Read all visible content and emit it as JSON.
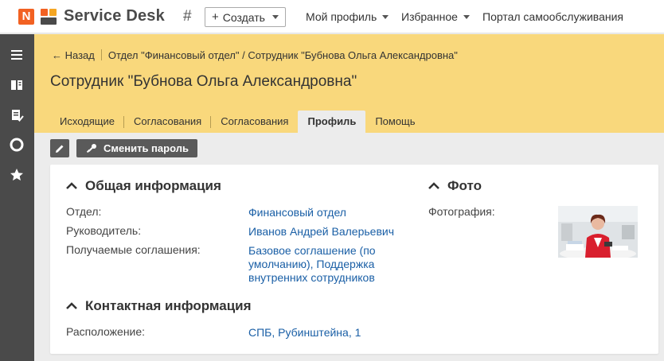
{
  "app": {
    "logo_letter": "N",
    "name": "Service Desk",
    "hash_symbol": "#",
    "create_label": "Создать",
    "create_plus": "+",
    "nav": [
      {
        "label": "Мой профиль"
      },
      {
        "label": "Избранное"
      },
      {
        "label": "Портал самообслуживания"
      }
    ]
  },
  "sidebar": {
    "items": [
      "menu-icon",
      "book-icon",
      "task-list-icon",
      "lifebuoy-icon",
      "star-icon"
    ]
  },
  "breadcrumb": {
    "back": "← Назад",
    "path": "Отдел \"Финансовый отдел\" / Сотрудник \"Бубнова Ольга Александровна\""
  },
  "page_title": "Сотрудник \"Бубнова Ольга Александровна\"",
  "tabs": [
    {
      "label": "Исходящие"
    },
    {
      "label": "Согласования"
    },
    {
      "label": "Согласования"
    },
    {
      "label": "Профиль"
    },
    {
      "label": "Помощь"
    }
  ],
  "toolbar": {
    "change_password": "Сменить пароль"
  },
  "general": {
    "title": "Общая информация",
    "department_label": "Отдел:",
    "department_value": "Финансовый отдел",
    "manager_label": "Руководитель:",
    "manager_value": "Иванов Андрей Валерьевич",
    "agreements_label": "Получаемые соглашения:",
    "agreements_line1": "Базовое соглашение (по",
    "agreements_line2": "умолчанию), Поддержка",
    "agreements_line3": "внутренних сотрудников"
  },
  "photo_section": {
    "title": "Фото",
    "label": "Фотография:"
  },
  "contact": {
    "title": "Контактная информация",
    "location_label": "Расположение:",
    "location_value": "СПБ, Рубинштейна, 1"
  },
  "colors": {
    "brand_orange": "#f26122",
    "header_yellow": "#f9d87c",
    "sidebar_dark": "#4a4a4a",
    "link_blue": "#1a5fa6"
  }
}
